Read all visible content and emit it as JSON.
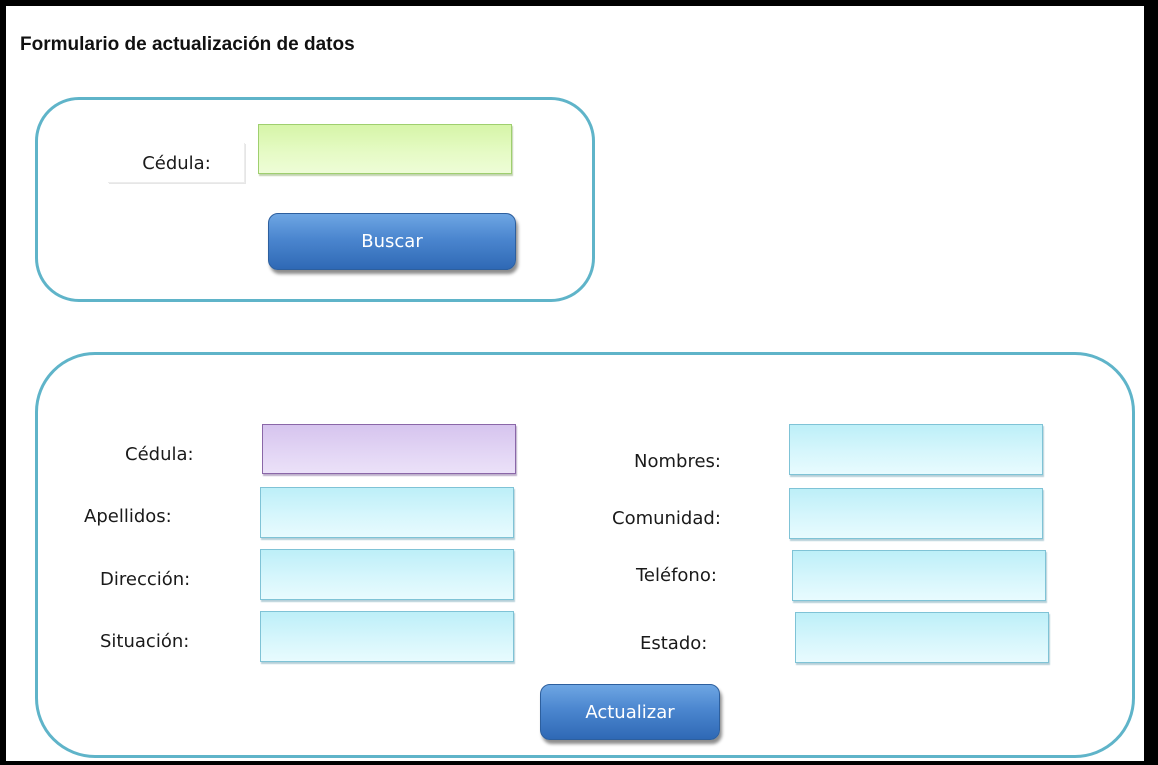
{
  "form": {
    "title": "Formulario de actualización  de datos"
  },
  "search_panel": {
    "cedula_label": "Cédula:",
    "cedula_value": "",
    "search_button": "Buscar"
  },
  "details_panel": {
    "left_fields": [
      {
        "label": "Cédula:",
        "value": ""
      },
      {
        "label": "Apellidos:",
        "value": ""
      },
      {
        "label": "Dirección:",
        "value": ""
      },
      {
        "label": "Situación:",
        "value": ""
      }
    ],
    "right_fields": [
      {
        "label": "Nombres:",
        "value": ""
      },
      {
        "label": "Comunidad:",
        "value": ""
      },
      {
        "label": "Teléfono:",
        "value": ""
      },
      {
        "label": "Estado:",
        "value": ""
      }
    ],
    "update_button": "Actualizar"
  },
  "colors": {
    "panel_border": "#5fb4c9",
    "field_cyan": "#d6f6fc",
    "field_green": "#e6fbc6",
    "field_purple": "#e3d6f5",
    "button_blue": "#4b86cf"
  }
}
